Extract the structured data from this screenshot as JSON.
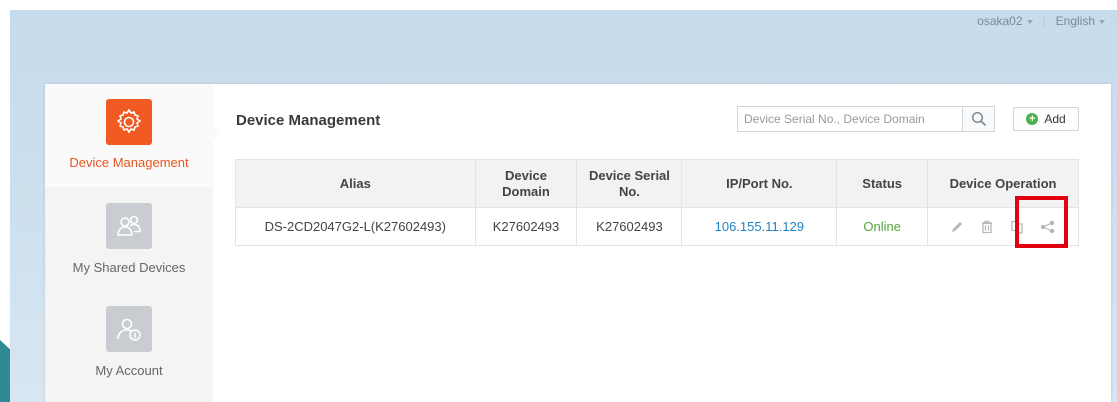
{
  "top_bar": {
    "user": "osaka02",
    "language": "English"
  },
  "sidebar": {
    "items": [
      {
        "label": "Device Management",
        "icon": "gear-icon",
        "active": true
      },
      {
        "label": "My Shared Devices",
        "icon": "shared-users-icon",
        "active": false
      },
      {
        "label": "My Account",
        "icon": "account-icon",
        "active": false
      }
    ]
  },
  "main": {
    "title": "Device Management",
    "search": {
      "placeholder": "Device Serial No., Device Domain",
      "value": ""
    },
    "add_label": "Add"
  },
  "table": {
    "headers": [
      "Alias",
      "Device Domain",
      "Device Serial No.",
      "IP/Port No.",
      "Status",
      "Device Operation"
    ],
    "rows": [
      {
        "alias": "DS-2CD2047G2-L(K27602493)",
        "domain": "K27602493",
        "serial": "K27602493",
        "ip": "106.155.11.129",
        "status": "Online",
        "operations": [
          "edit-icon",
          "delete-icon",
          "copy-icon",
          "share-icon"
        ]
      }
    ]
  },
  "colors": {
    "accent": "#f15a22",
    "link": "#1f84c4",
    "online": "#55a33a",
    "highlight": "#e3000f"
  }
}
